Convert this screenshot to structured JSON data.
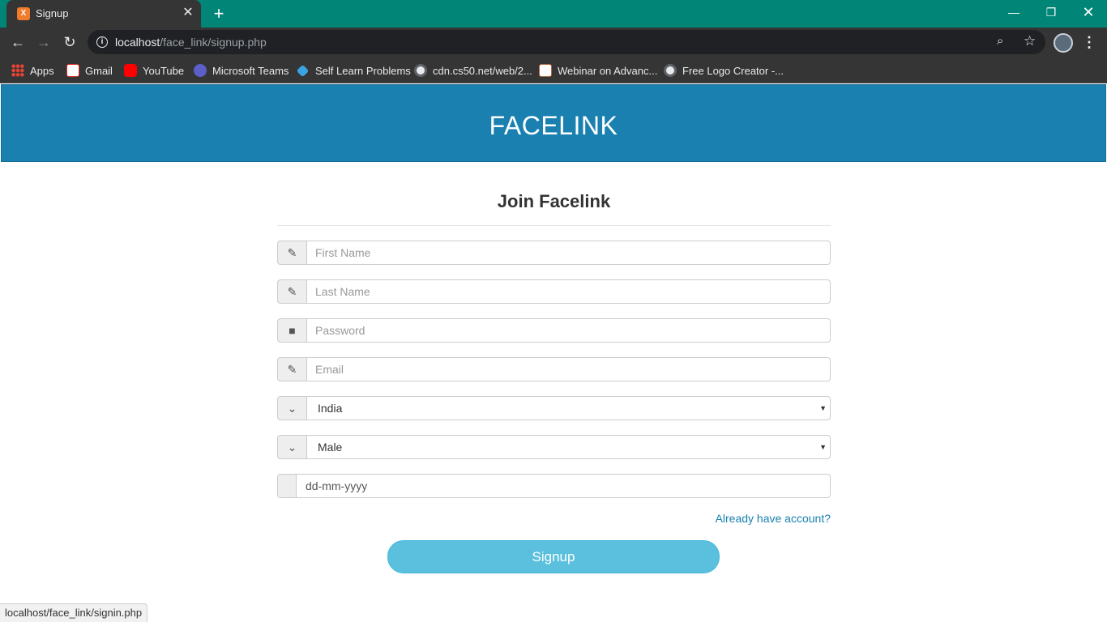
{
  "browser": {
    "tab_title": "Signup",
    "tab_close": "✕",
    "new_tab": "+",
    "url_host": "localhost",
    "url_path": "/face_link/signup.php",
    "window_buttons": {
      "minimize": "—",
      "restore": "❐",
      "close": "✕"
    }
  },
  "bookmarks": [
    {
      "label": "Apps",
      "icon": "apps-grid-icon"
    },
    {
      "label": "Gmail",
      "icon": "gmail-icon"
    },
    {
      "label": "YouTube",
      "icon": "youtube-icon"
    },
    {
      "label": "Microsoft Teams",
      "icon": "teams-icon"
    },
    {
      "label": "Self Learn Problems",
      "icon": "self-learn-icon"
    },
    {
      "label": "cdn.cs50.net/web/2...",
      "icon": "globe-icon"
    },
    {
      "label": "Webinar on Advanc...",
      "icon": "webinar-icon"
    },
    {
      "label": "Free Logo Creator -...",
      "icon": "globe-icon"
    }
  ],
  "header": {
    "brand": "FACELINK",
    "color": "#1a80b0"
  },
  "form": {
    "title": "Join Facelink",
    "first_name_placeholder": "First Name",
    "last_name_placeholder": "Last Name",
    "password_placeholder": "Password",
    "email_placeholder": "Email",
    "country_selected": "India",
    "gender_selected": "Male",
    "dob_placeholder": "dd-mm-yyyy",
    "signin_link": "Already have account?",
    "submit_label": "Signup",
    "submit_color": "#5bc0de"
  },
  "status_bar": {
    "url": "localhost/face_link/signin.php"
  }
}
